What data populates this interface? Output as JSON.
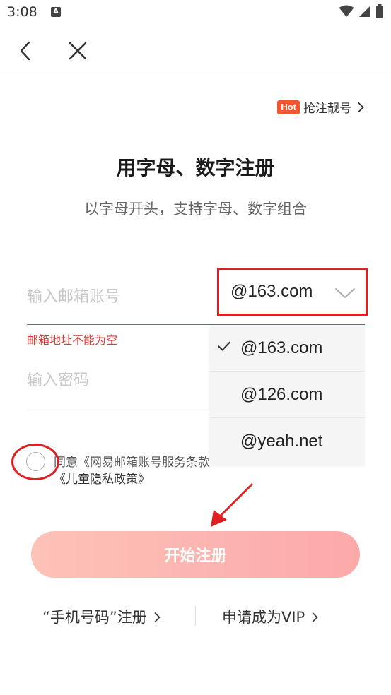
{
  "status_bar": {
    "time": "3:08",
    "notification_icon": "A"
  },
  "nav": {
    "back_icon": "chevron-left-icon",
    "close_icon": "close-icon"
  },
  "hot": {
    "badge": "Hot",
    "label": "抢注靓号"
  },
  "title": "用字母、数字注册",
  "subtitle": "以字母开头，支持字母、数字组合",
  "email": {
    "placeholder": "输入邮箱账号",
    "value": ""
  },
  "domain": {
    "selected": "@163.com"
  },
  "error": "邮箱地址不能为空",
  "password": {
    "placeholder": "输入密码",
    "value": ""
  },
  "dropdown": {
    "options": [
      {
        "label": "@163.com",
        "checked": true
      },
      {
        "label": "@126.com",
        "checked": false
      },
      {
        "label": "@yeah.net",
        "checked": false
      }
    ]
  },
  "agreement": {
    "line1": "同意《网易邮箱账号服务条款》《隐私政策》",
    "line2": "《儿童隐私政策》"
  },
  "register_button": "开始注册",
  "bottom_links": {
    "phone": "“手机号码”注册",
    "vip": "申请成为VIP"
  },
  "colors": {
    "accent": "#e43a3a",
    "hot": "#f0552d",
    "button_start": "#fdc2b8",
    "button_end": "#fca9a9",
    "annotation": "#e02020"
  }
}
